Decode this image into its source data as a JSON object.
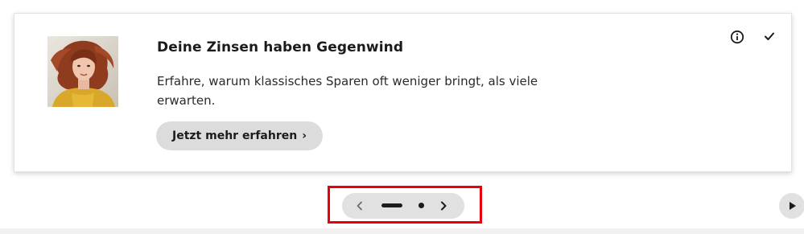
{
  "teaser": {
    "image_alt": "Frau mit roten Haaren im gelben Oberteil",
    "title": "Deine Zinsen haben Gegenwind",
    "description": "Erfahre, warum klassisches Sparen oft weniger bringt, als viele erwarten.",
    "cta_label": "Jetzt mehr erfahren",
    "cta_icon": "chevron-right-icon",
    "info_icon": "info-icon",
    "dismiss_icon": "check-icon"
  },
  "carousel": {
    "prev_icon": "chevron-left-icon",
    "next_icon": "chevron-right-icon",
    "pages": 2,
    "active_page": 1,
    "play_icon": "play-icon"
  },
  "colors": {
    "card_bg": "#ffffff",
    "button_bg": "#dcdcdc",
    "pager_bg": "#e1e1e1",
    "highlight": "#e8000d",
    "text": "#1b1b1b"
  }
}
